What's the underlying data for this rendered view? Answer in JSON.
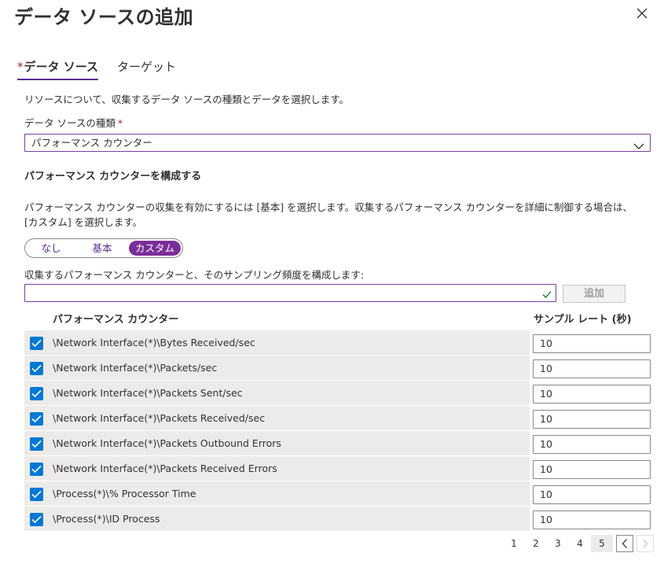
{
  "panel": {
    "title": "データ ソースの追加",
    "close_icon": "close-icon"
  },
  "tabs": [
    {
      "label": "データ ソース",
      "required_mark": "*",
      "active": true
    },
    {
      "label": "ターゲット",
      "active": false
    }
  ],
  "intro_text": "リソースについて、収集するデータ ソースの種類とデータを選択します。",
  "data_source_type": {
    "label": "データ ソースの種類",
    "required_mark": "*",
    "selected": "パフォーマンス カウンター"
  },
  "configure": {
    "title": "パフォーマンス カウンターを構成する",
    "description": "パフォーマンス カウンターの収集を有効にするには [基本] を選択します。収集するパフォーマンス カウンターを詳細に制御する場合は、[カスタム] を選択します。",
    "toggle_options": [
      "なし",
      "基本",
      "カスタム"
    ],
    "toggle_selected": "カスタム",
    "sampling_text": "収集するパフォーマンス カウンターと、そのサンプリング頻度を構成します:",
    "counter_input_value": "",
    "add_button": "追加"
  },
  "table": {
    "headers": {
      "counter": "パフォーマンス カウンター",
      "rate": "サンプル レート (秒)"
    },
    "rows": [
      {
        "counter": "\\Network Interface(*)\\Bytes Received/sec",
        "rate": "10",
        "checked": true
      },
      {
        "counter": "\\Network Interface(*)\\Packets/sec",
        "rate": "10",
        "checked": true
      },
      {
        "counter": "\\Network Interface(*)\\Packets Sent/sec",
        "rate": "10",
        "checked": true
      },
      {
        "counter": "\\Network Interface(*)\\Packets Received/sec",
        "rate": "10",
        "checked": true
      },
      {
        "counter": "\\Network Interface(*)\\Packets Outbound Errors",
        "rate": "10",
        "checked": true
      },
      {
        "counter": "\\Network Interface(*)\\Packets Received Errors",
        "rate": "10",
        "checked": true
      },
      {
        "counter": "\\Process(*)\\% Processor Time",
        "rate": "10",
        "checked": true
      },
      {
        "counter": "\\Process(*)\\ID Process",
        "rate": "10",
        "checked": true
      }
    ]
  },
  "pagination": {
    "pages": [
      "1",
      "2",
      "3",
      "4",
      "5"
    ],
    "current": "5"
  },
  "colors": {
    "accent": "#7a2d99",
    "checkbox": "#0078d4",
    "required": "#a4262c"
  }
}
